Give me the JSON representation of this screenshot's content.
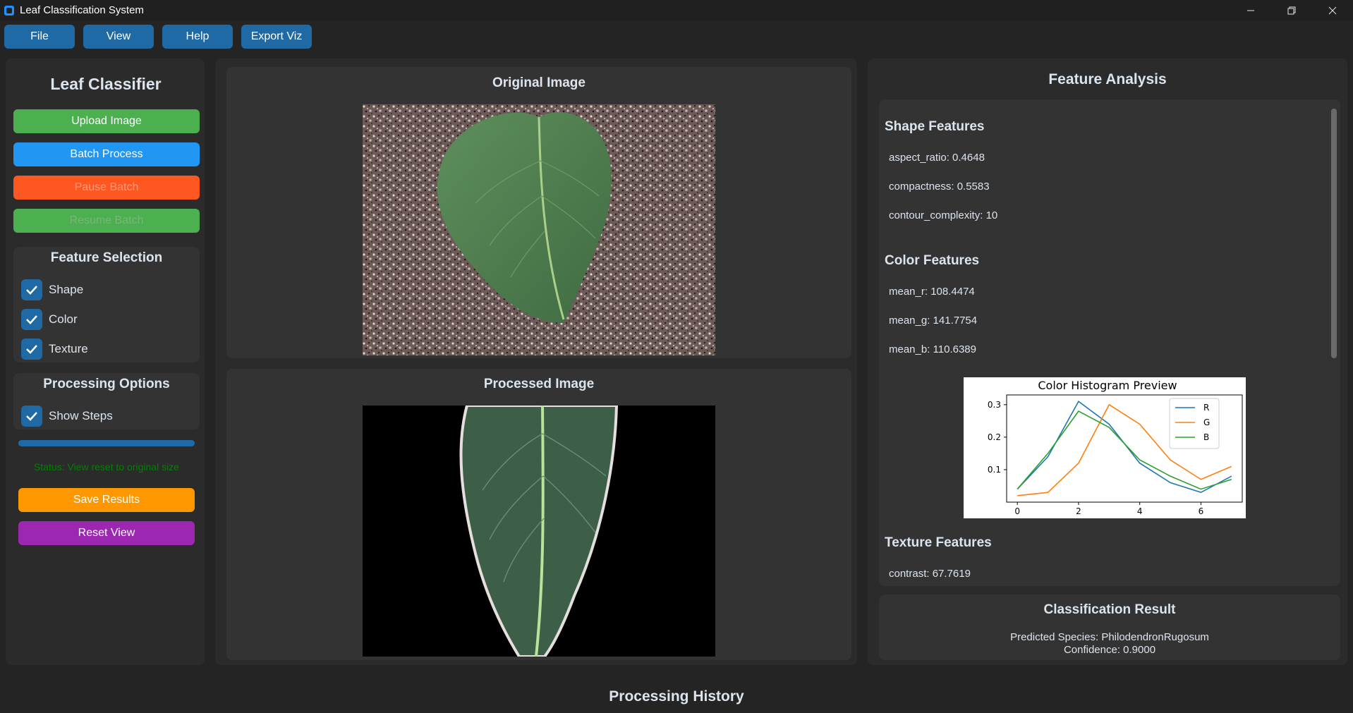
{
  "window": {
    "title": "Leaf Classification System"
  },
  "menu": {
    "file": "File",
    "view": "View",
    "help": "Help",
    "export": "Export Viz"
  },
  "sidebar": {
    "title": "Leaf Classifier",
    "upload": "Upload Image",
    "batch": "Batch Process",
    "pause": "Pause Batch",
    "resume": "Resume Batch",
    "feature_selection": {
      "title": "Feature Selection",
      "shape": "Shape",
      "color": "Color",
      "texture": "Texture"
    },
    "processing_options": {
      "title": "Processing Options",
      "show_steps": "Show Steps"
    },
    "progress": 1.0,
    "status": "Status: View reset to original size",
    "save": "Save Results",
    "reset": "Reset View"
  },
  "images": {
    "original_title": "Original Image",
    "processed_title": "Processed Image"
  },
  "features": {
    "title": "Feature Analysis",
    "shape": {
      "title": "Shape Features",
      "lines": [
        "aspect_ratio: 0.4648",
        "compactness: 0.5583",
        "contour_complexity: 10"
      ]
    },
    "color": {
      "title": "Color Features",
      "lines": [
        "mean_r: 108.4474",
        "mean_g: 141.7754",
        "mean_b: 110.6389"
      ]
    },
    "texture": {
      "title": "Texture Features",
      "lines": [
        "contrast: 67.7619"
      ]
    }
  },
  "chart_data": {
    "type": "line",
    "title": "Color Histogram Preview",
    "xlabel": "",
    "ylabel": "",
    "x": [
      0,
      1,
      2,
      3,
      4,
      5,
      6,
      7
    ],
    "xticks": [
      "0",
      "2",
      "4",
      "6"
    ],
    "yticks": [
      "0.1",
      "0.2",
      "0.3"
    ],
    "xlim": [
      -0.35,
      7.35
    ],
    "ylim": [
      0.0,
      0.33
    ],
    "legend": "top-right",
    "series": [
      {
        "name": "R",
        "color": "#1f77b4",
        "values": [
          0.04,
          0.14,
          0.31,
          0.24,
          0.12,
          0.06,
          0.03,
          0.08
        ]
      },
      {
        "name": "G",
        "color": "#ff7f0e",
        "values": [
          0.02,
          0.03,
          0.12,
          0.3,
          0.24,
          0.13,
          0.07,
          0.11
        ]
      },
      {
        "name": "B",
        "color": "#2ca02c",
        "values": [
          0.04,
          0.15,
          0.28,
          0.23,
          0.13,
          0.08,
          0.04,
          0.07
        ]
      }
    ]
  },
  "classification": {
    "title": "Classification Result",
    "species": "Predicted Species: PhilodendronRugosum",
    "confidence": "Confidence: 0.9000"
  },
  "history": {
    "title": "Processing History"
  },
  "colors": {
    "accent": "#1f6aa5",
    "green": "#4caf50",
    "blue": "#2196f3",
    "orange_red": "#ff5722",
    "orange": "#ff9800",
    "purple": "#9c27b0",
    "status_green": "#008000"
  }
}
